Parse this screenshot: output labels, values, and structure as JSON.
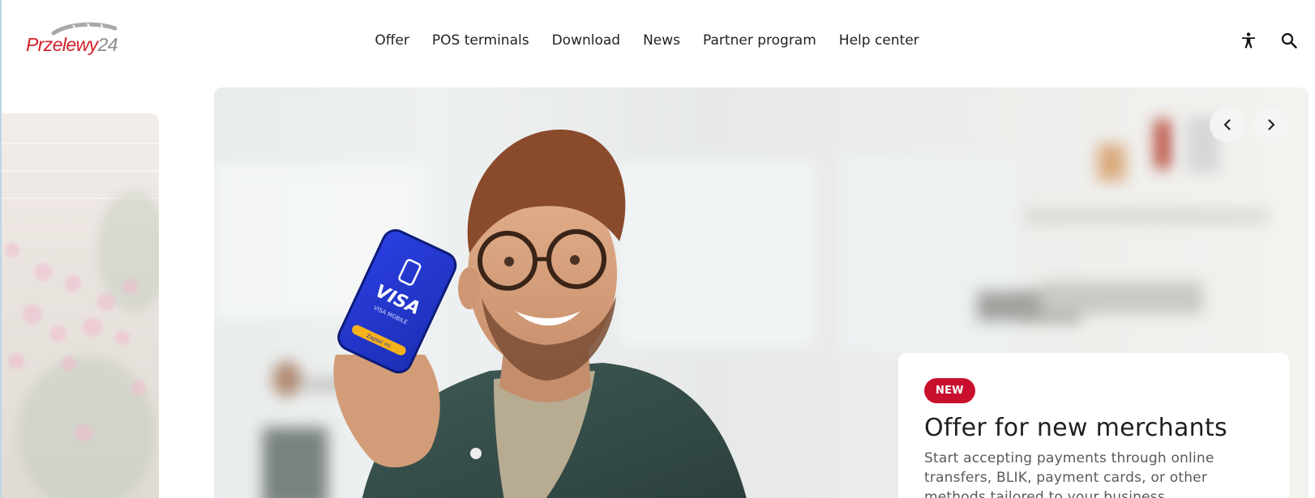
{
  "brand": {
    "logo_part1": "Przelewy",
    "logo_part2": "24",
    "primary_color": "#d1202b",
    "secondary_color": "#8c8c8c"
  },
  "nav": {
    "items": [
      {
        "label": "Offer"
      },
      {
        "label": "POS terminals"
      },
      {
        "label": "Download"
      },
      {
        "label": "News"
      },
      {
        "label": "Partner program"
      },
      {
        "label": "Help center"
      }
    ]
  },
  "tools": {
    "accessibility_icon": "accessibility-icon",
    "search_icon": "search-icon"
  },
  "hero": {
    "phone_brand": "VISA",
    "phone_caption": "VISA MOBILE",
    "phone_button": "Zapłać mi",
    "prev_icon": "chevron-left-icon",
    "next_icon": "chevron-right-icon",
    "card": {
      "badge": "NEW",
      "badge_color": "#c8102e",
      "title": "Offer for new merchants",
      "description": "Start accepting payments through online transfers, BLIK, payment cards, or other methods tailored to your business."
    }
  }
}
